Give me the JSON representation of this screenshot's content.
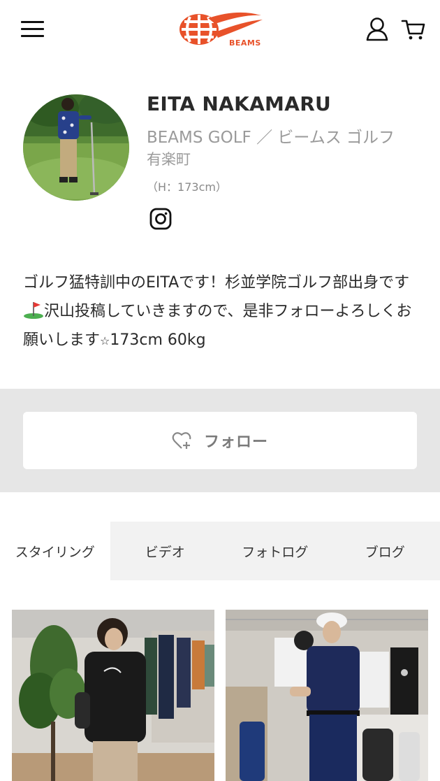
{
  "header": {
    "logo_text": "BEAMS",
    "brand_color": "#e8522a",
    "icons": [
      "menu-icon",
      "user-icon",
      "cart-icon"
    ]
  },
  "profile": {
    "name": "EITA NAKAMARU",
    "shop_line1": "BEAMS GOLF ／ ビームス ゴルフ",
    "shop_line2": "有楽町",
    "height": "（H：173cm）",
    "social_icon": "instagram-icon"
  },
  "bio": {
    "text_before_flag": "ゴルフ猛特訓中のEITAです！杉並学院ゴルフ部出身です",
    "text_after_flag": "沢山投稿していきますので、是非フォローよろしくお願いします",
    "star": "☆",
    "text_end": "173cm 60kg"
  },
  "follow": {
    "label": "フォロー",
    "icon": "heart-plus-icon"
  },
  "tabs": [
    {
      "label": "スタイリング",
      "active": true
    },
    {
      "label": "ビデオ",
      "active": false
    },
    {
      "label": "フォトログ",
      "active": false
    },
    {
      "label": "ブログ",
      "active": false
    }
  ]
}
